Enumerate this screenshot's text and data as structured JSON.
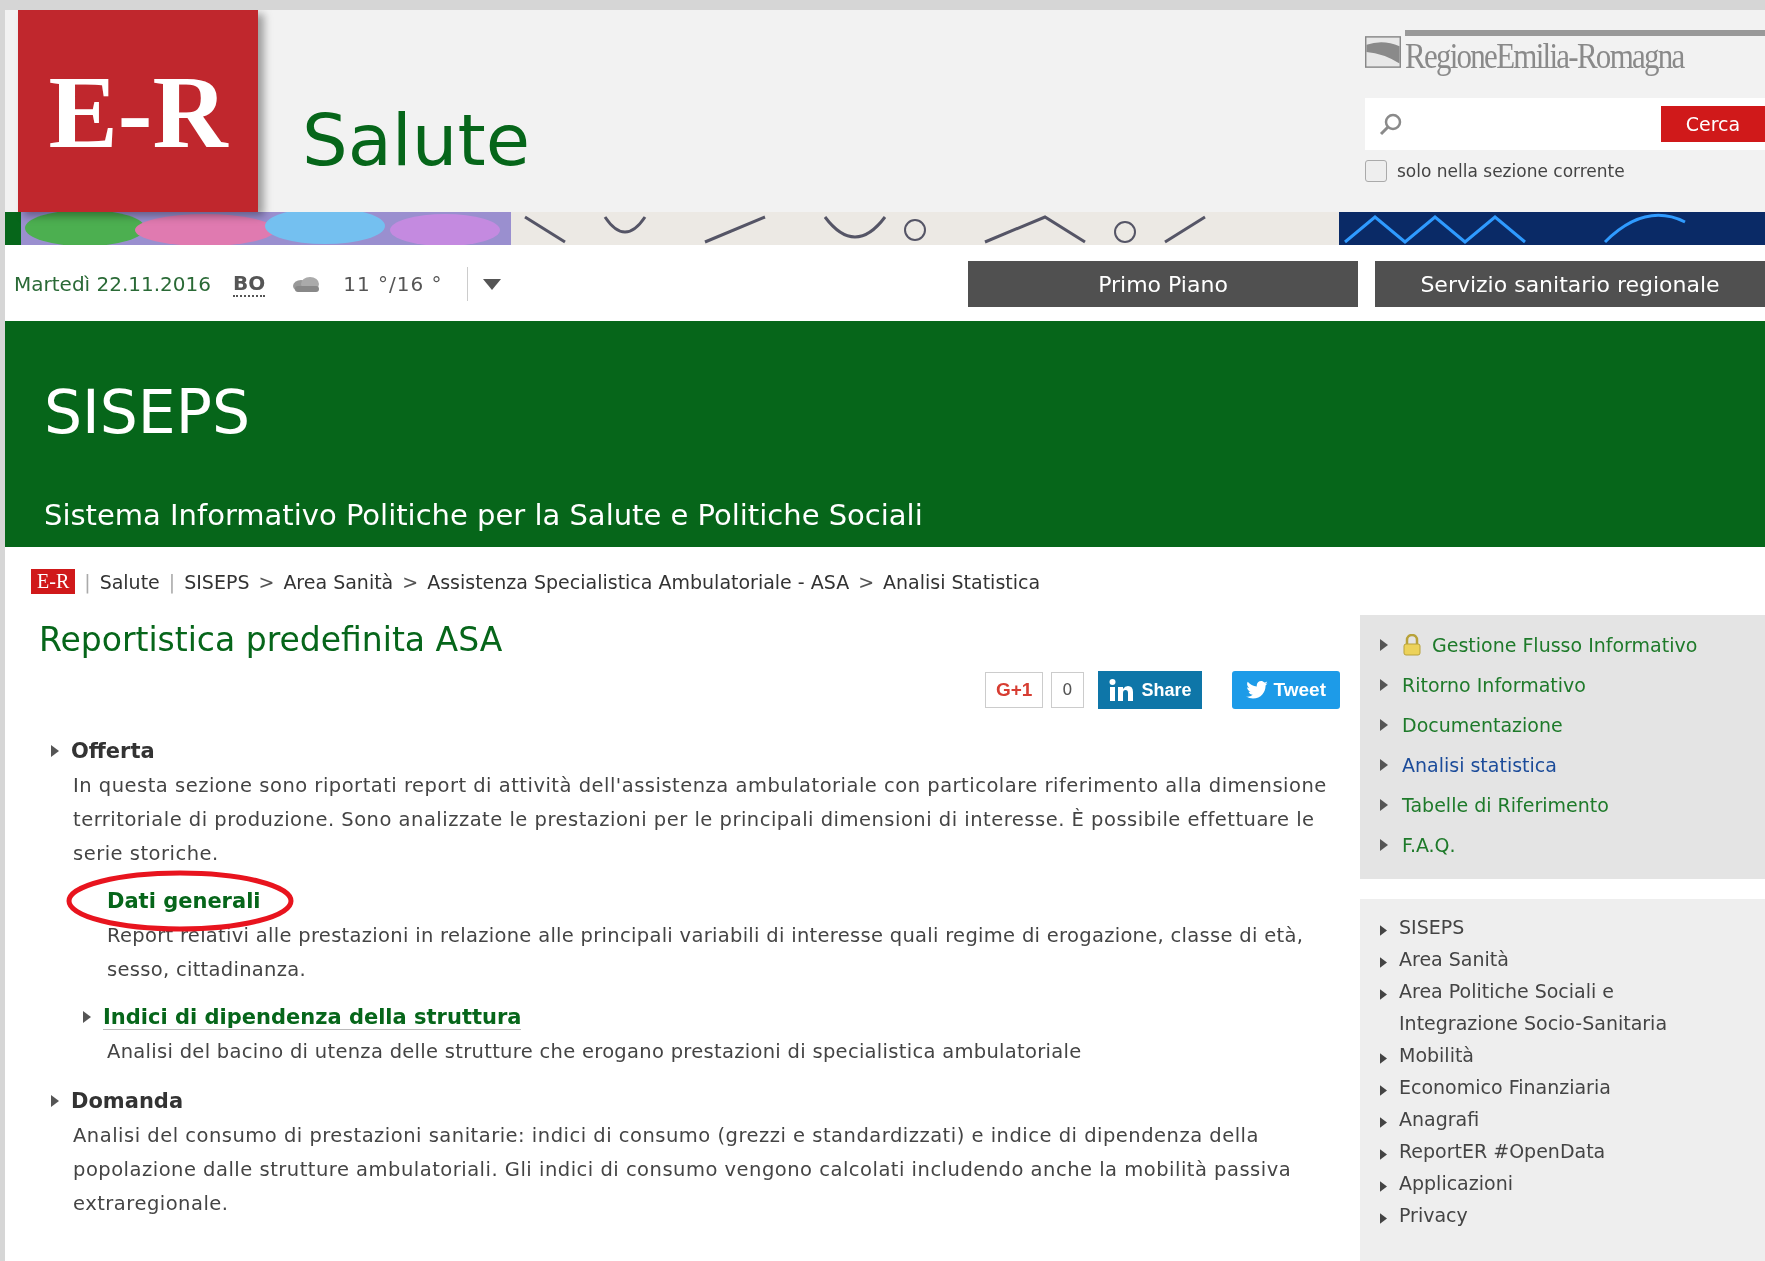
{
  "header": {
    "logo_text": "E-R",
    "site_title": "Salute",
    "region_logo": "RegioneEmilia-Romagna",
    "search": {
      "button": "Cerca"
    },
    "scope_checkbox": {
      "label": "solo nella sezione corrente",
      "checked": false
    }
  },
  "infobar": {
    "date": "Martedì 22.11.2016",
    "city": "BO",
    "temperature": "11 °/16 °",
    "nav_buttons": [
      "Primo Piano",
      "Servizio sanitario regionale"
    ]
  },
  "hero": {
    "title": "SISEPS",
    "subtitle": "Sistema Informativo Politiche per la Salute e Politiche Sociali"
  },
  "breadcrumb": {
    "logo_text": "E-R",
    "items": [
      {
        "separator": "|",
        "label": "Salute"
      },
      {
        "separator": "|",
        "label": "SISEPS"
      },
      {
        "separator": ">",
        "label": "Area Sanità"
      },
      {
        "separator": ">",
        "label": "Assistenza Specialistica Ambulatoriale - ASA"
      },
      {
        "separator": ">",
        "label": "Analisi Statistica"
      }
    ]
  },
  "page_title": "Reportistica predefinita ASA",
  "social": {
    "gplus_label": "G+1",
    "gplus_count": "0",
    "linkedin_label": "Share",
    "twitter_label": "Tweet"
  },
  "sections": [
    {
      "title": "Offerta",
      "text": "In questa sezione sono riportati report di attività dell'assistenza ambulatoriale con particolare riferimento alla dimensione territoriale di produzione. Sono analizzate le prestazioni per le principali dimensioni di interesse. È possibile effettuare le serie storiche.",
      "children": [
        {
          "title": "Dati generali",
          "circled": true,
          "text": "Report relativi alle prestazioni in relazione alle principali variabili di interesse quali regime di erogazione, classe di età, sesso, cittadinanza."
        },
        {
          "title": "Indici di dipendenza della struttura",
          "circled": false,
          "text": "Analisi del bacino di utenza delle strutture che erogano prestazioni di specialistica ambulatoriale"
        }
      ]
    },
    {
      "title": "Domanda",
      "text": "Analisi del consumo di prestazioni sanitarie: indici di consumo (grezzi e standardizzati) e indice di dipendenza della popolazione dalle strutture ambulatoriali. Gli indici di consumo vengono calcolati includendo anche la mobilità passiva extraregionale."
    }
  ],
  "sidebar_menu": [
    {
      "label": "Gestione Flusso Informativo",
      "locked": true,
      "selected": false
    },
    {
      "label": "Ritorno Informativo",
      "locked": false,
      "selected": false
    },
    {
      "label": "Documentazione",
      "locked": false,
      "selected": false
    },
    {
      "label": "Analisi statistica",
      "locked": false,
      "selected": true
    },
    {
      "label": "Tabelle di Riferimento",
      "locked": false,
      "selected": false
    },
    {
      "label": "F.A.Q.",
      "locked": false,
      "selected": false
    }
  ],
  "sidebar_links": [
    "SISEPS",
    "Area Sanità",
    "Area Politiche Sociali e Integrazione Socio-Sanitaria",
    "Mobilità",
    "Economico Finanziaria",
    "Anagrafi",
    "ReportER #OpenData",
    "Applicazioni",
    "Privacy"
  ]
}
